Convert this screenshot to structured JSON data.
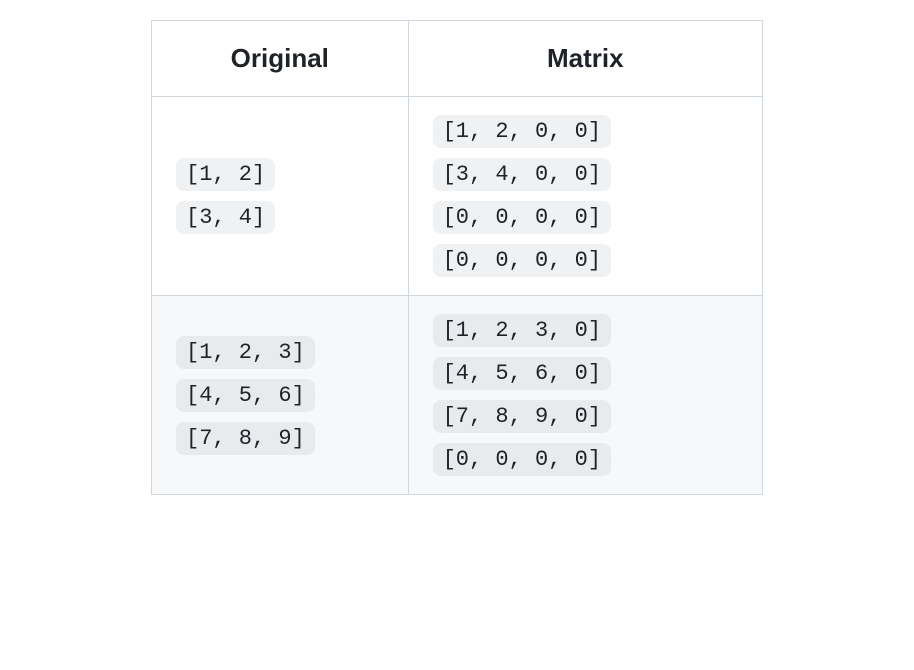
{
  "headers": {
    "col1": "Original",
    "col2": "Matrix"
  },
  "rows": [
    {
      "original": [
        "[1, 2]",
        "[3, 4]"
      ],
      "matrix": [
        "[1, 2, 0, 0]",
        "[3, 4, 0, 0]",
        "[0, 0, 0, 0]",
        "[0, 0, 0, 0]"
      ]
    },
    {
      "original": [
        "[1, 2, 3]",
        "[4, 5, 6]",
        "[7, 8, 9]"
      ],
      "matrix": [
        "[1, 2, 3, 0]",
        "[4, 5, 6, 0]",
        "[7, 8, 9, 0]",
        "[0, 0, 0, 0]"
      ]
    }
  ]
}
